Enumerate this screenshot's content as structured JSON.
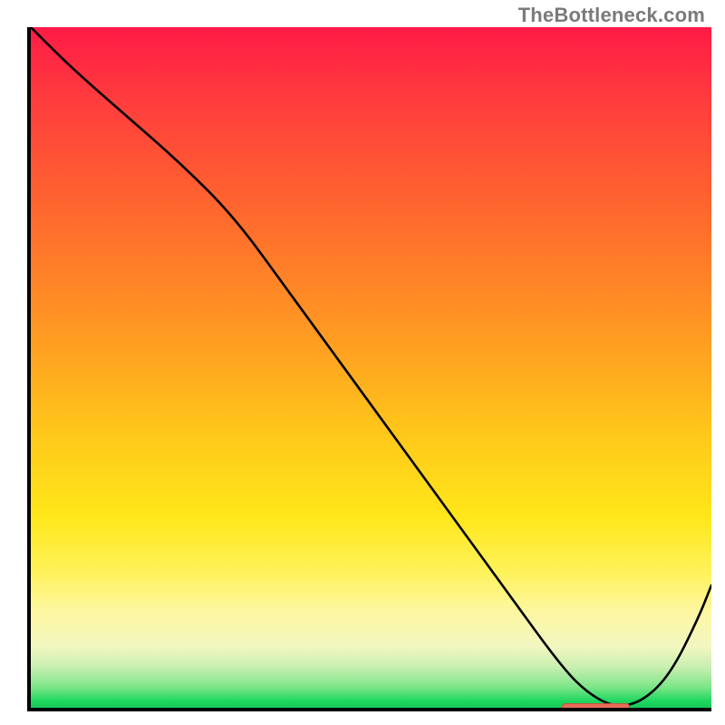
{
  "watermark": "TheBottleneck.com",
  "colors": {
    "gradient_top": "#ff1b46",
    "gradient_mid_orange": "#ff9a22",
    "gradient_mid_yellow": "#ffe71a",
    "gradient_green": "#1ed760",
    "curve": "#000000",
    "axis": "#000000",
    "marker": "#e86b57"
  },
  "chart_data": {
    "type": "line",
    "title": "",
    "xlabel": "",
    "ylabel": "",
    "xlim": [
      0,
      100
    ],
    "ylim": [
      0,
      100
    ],
    "grid": false,
    "legend": false,
    "x": [
      0,
      6,
      14,
      22,
      30,
      38,
      46,
      54,
      62,
      70,
      78,
      82,
      86,
      90,
      94,
      98,
      100
    ],
    "values": [
      100,
      94,
      87,
      80,
      72,
      61,
      50,
      39,
      28,
      17,
      6,
      2,
      0,
      1,
      5,
      13,
      18
    ],
    "marker": {
      "x_start": 78,
      "x_end": 88,
      "y": 0
    }
  }
}
